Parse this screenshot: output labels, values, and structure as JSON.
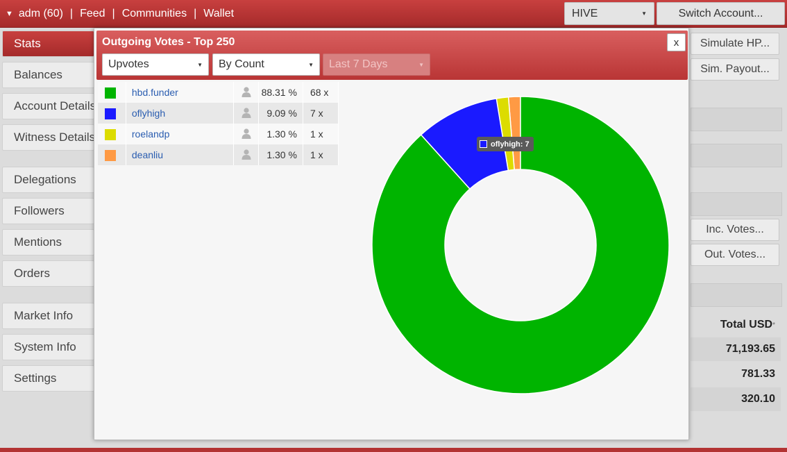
{
  "topbar": {
    "account": "adm (60)",
    "nav": [
      "Feed",
      "Communities",
      "Wallet"
    ],
    "currency": "HIVE",
    "switch_label": "Switch Account..."
  },
  "sidebar": {
    "items": [
      {
        "label": "Stats",
        "active": true
      },
      {
        "label": "Balances"
      },
      {
        "label": "Account Details"
      },
      {
        "label": "Witness Details"
      },
      {
        "label": "Delegations"
      },
      {
        "label": "Followers"
      },
      {
        "label": "Mentions"
      },
      {
        "label": "Orders"
      },
      {
        "label": "Market Info"
      },
      {
        "label": "System Info"
      },
      {
        "label": "Settings"
      }
    ]
  },
  "right": {
    "simulate_hp": "Simulate HP...",
    "sim_payout": "Sim. Payout...",
    "inc_votes": "Inc. Votes...",
    "out_votes": "Out. Votes...",
    "total_usd_header": "Total USD",
    "total_usd_mark": "*",
    "values": [
      "71,193.65",
      "781.33",
      "320.10"
    ]
  },
  "modal": {
    "title": "Outgoing Votes - Top 250",
    "close_label": "x",
    "vote_type": "Upvotes",
    "sort_by": "By Count",
    "period": "Last 7 Days",
    "rows": [
      {
        "name": "hbd.funder",
        "percent": "88.31 %",
        "count": "68 x",
        "color": "#00b400"
      },
      {
        "name": "oflyhigh",
        "percent": "9.09 %",
        "count": "7 x",
        "color": "#1a1aff"
      },
      {
        "name": "roelandp",
        "percent": "1.30 %",
        "count": "1 x",
        "color": "#dcdc00"
      },
      {
        "name": "deanliu",
        "percent": "1.30 %",
        "count": "1 x",
        "color": "#ff9a44"
      }
    ],
    "tooltip": "oflyhigh: 7"
  },
  "chart_data": {
    "type": "pie",
    "donut": true,
    "categories": [
      "hbd.funder",
      "oflyhigh",
      "roelandp",
      "deanliu"
    ],
    "values": [
      68,
      7,
      1,
      1
    ],
    "colors": [
      "#00b400",
      "#1a1aff",
      "#dcdc00",
      "#ff9a44"
    ]
  }
}
